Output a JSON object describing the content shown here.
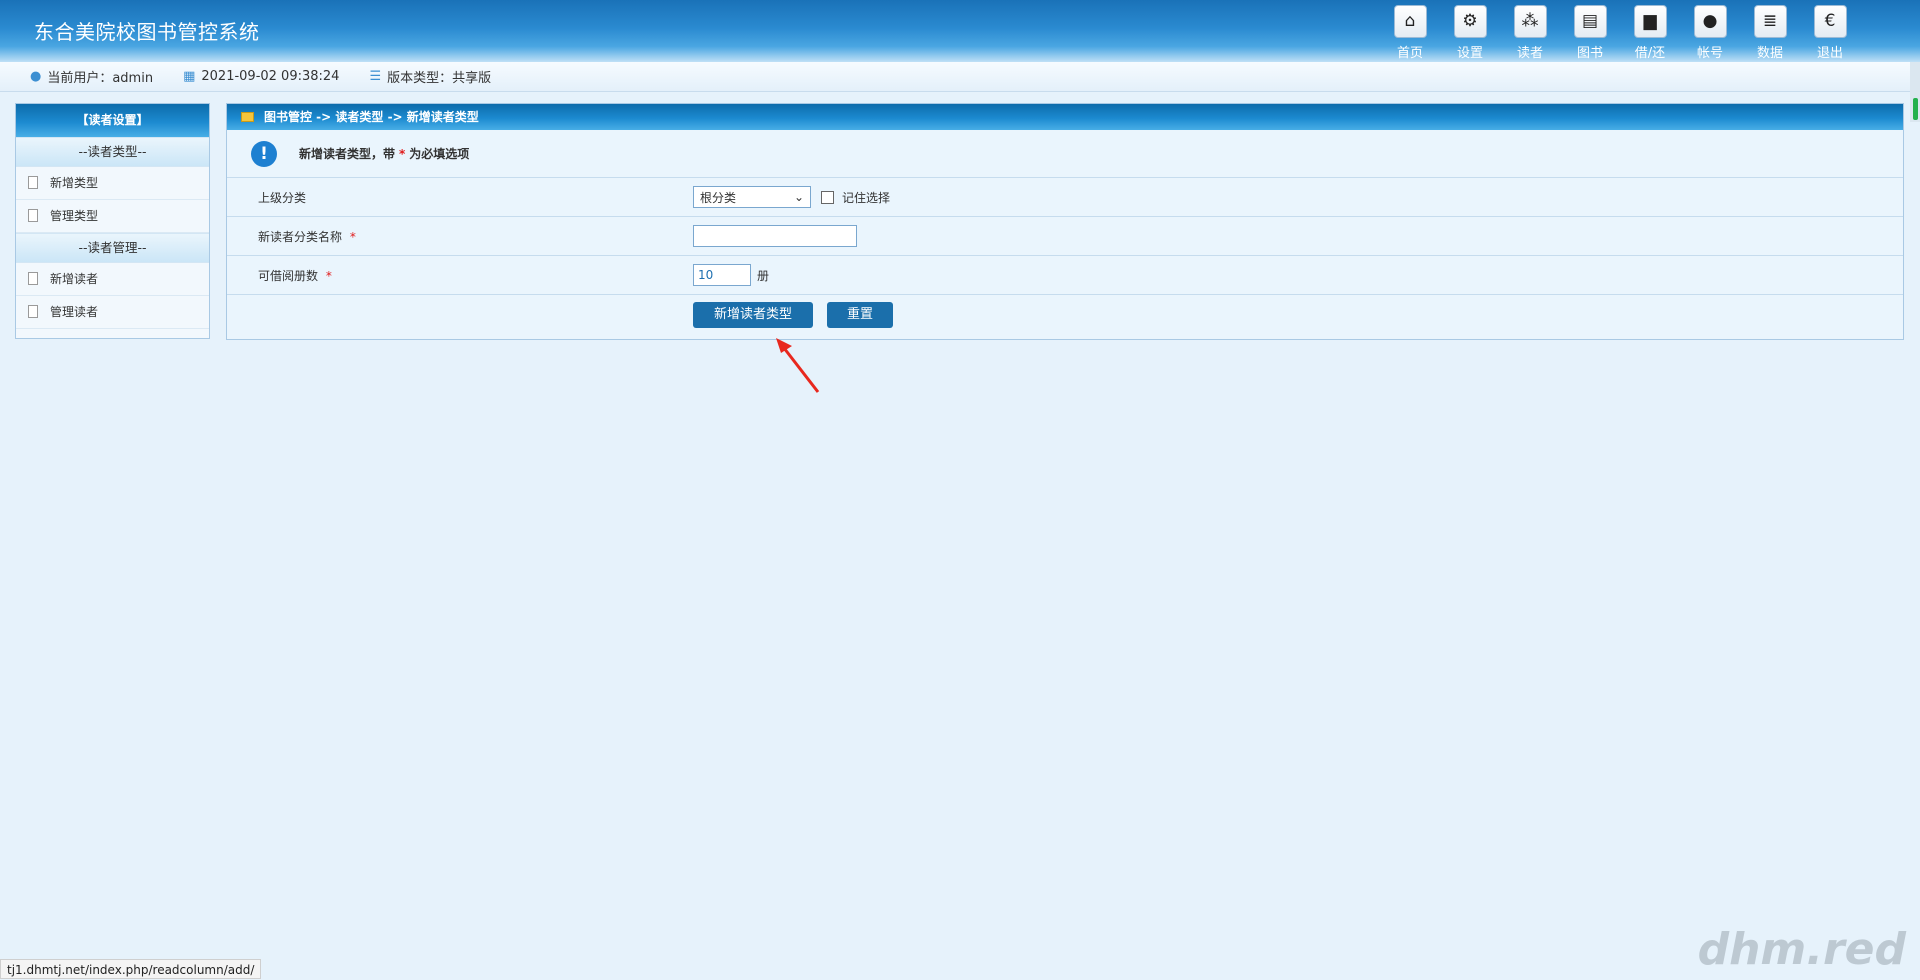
{
  "app": {
    "title": "东合美院校图书管控系统"
  },
  "nav": [
    {
      "label": "首页",
      "icon": "home-icon",
      "glyph": "⌂"
    },
    {
      "label": "设置",
      "icon": "gear-icon",
      "glyph": "⚙"
    },
    {
      "label": "读者",
      "icon": "readers-icon",
      "glyph": "⁂"
    },
    {
      "label": "图书",
      "icon": "book-icon",
      "glyph": "▤"
    },
    {
      "label": "借/还",
      "icon": "folder-icon",
      "glyph": "▆"
    },
    {
      "label": "帐号",
      "icon": "user-icon",
      "glyph": "●"
    },
    {
      "label": "数据",
      "icon": "database-icon",
      "glyph": "≣"
    },
    {
      "label": "退出",
      "icon": "euro-icon",
      "glyph": "€"
    }
  ],
  "infobar": {
    "user_label": "当前用户：admin",
    "datetime": "2021-09-02 09:38:24",
    "version": "版本类型：共享版"
  },
  "sidebar": {
    "title": "【读者设置】",
    "groups": [
      {
        "label": "--读者类型--",
        "items": [
          "新增类型",
          "管理类型"
        ]
      },
      {
        "label": "--读者管理--",
        "items": [
          "新增读者",
          "管理读者"
        ]
      }
    ]
  },
  "main": {
    "breadcrumb": "图书管控 -> 读者类型 -> 新增读者类型",
    "notice_prefix": "新增读者类型，带",
    "notice_star": "*",
    "notice_suffix": "为必填选项",
    "fields": {
      "parent_label": "上级分类",
      "parent_value": "根分类",
      "remember_label": "记住选择",
      "name_label": "新读者分类名称",
      "name_value": "",
      "borrow_label": "可借阅册数",
      "borrow_value": "10",
      "borrow_unit": "册",
      "required_mark": "*"
    },
    "buttons": {
      "submit": "新增读者类型",
      "reset": "重置"
    }
  },
  "statusbar": {
    "url": "tj1.dhmtj.net/index.php/readcolumn/add/"
  },
  "watermark": "dhm.red",
  "colors": {
    "header": "#1a72b8",
    "accent": "#1b6fab",
    "required": "#e01b1b",
    "arrow": "#e8281e"
  }
}
